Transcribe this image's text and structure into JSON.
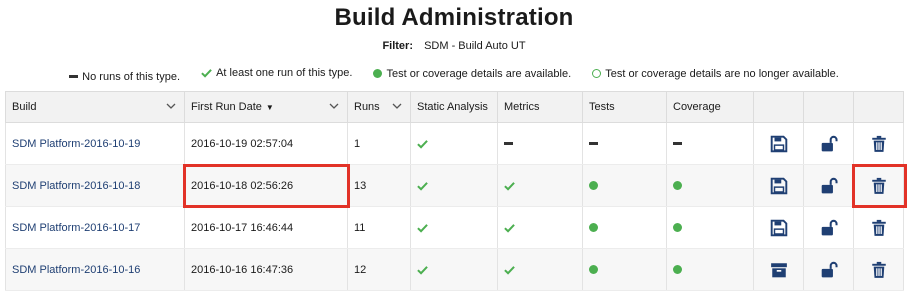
{
  "page": {
    "title": "Build Administration"
  },
  "filter": {
    "label": "Filter:",
    "value": "SDM - Build Auto UT"
  },
  "legend": [
    {
      "icon": "dash-icon",
      "text": "No runs of this type."
    },
    {
      "icon": "checkmark-icon",
      "text": "At least one run of this type."
    },
    {
      "icon": "filled-dot-icon",
      "text": "Test or coverage details are available."
    },
    {
      "icon": "hollow-dot-icon",
      "text": "Test or coverage details are no longer available."
    }
  ],
  "columns": {
    "build": "Build",
    "first_run": "First Run Date",
    "runs": "Runs",
    "static": "Static Analysis",
    "metrics": "Metrics",
    "tests": "Tests",
    "coverage": "Coverage"
  },
  "rows": [
    {
      "build": "SDM Platform-2016-10-19",
      "first_run": "2016-10-19 02:57:04",
      "runs": "1",
      "static": "check",
      "metrics": "dash",
      "tests": "dash",
      "coverage": "dash",
      "save_icon": "floppy-disk-icon"
    },
    {
      "build": "SDM Platform-2016-10-18",
      "first_run": "2016-10-18 02:56:26",
      "runs": "13",
      "static": "check",
      "metrics": "check",
      "tests": "dot",
      "coverage": "dot",
      "save_icon": "floppy-disk-icon"
    },
    {
      "build": "SDM Platform-2016-10-17",
      "first_run": "2016-10-17 16:46:44",
      "runs": "11",
      "static": "check",
      "metrics": "check",
      "tests": "dot",
      "coverage": "dot",
      "save_icon": "floppy-disk-icon"
    },
    {
      "build": "SDM Platform-2016-10-16",
      "first_run": "2016-10-16 16:47:36",
      "runs": "12",
      "static": "check",
      "metrics": "check",
      "tests": "dot",
      "coverage": "dot",
      "save_icon": "archive-box-icon"
    }
  ],
  "colors": {
    "accent": "#1f3f73",
    "status_green": "#4caf50",
    "highlight": "#e23227"
  }
}
